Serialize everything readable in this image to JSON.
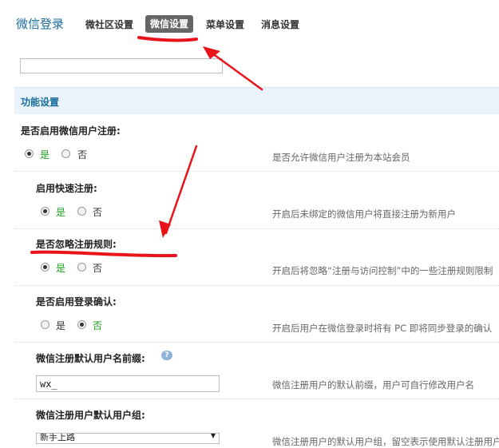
{
  "header": {
    "title": "微信登录",
    "tabs": [
      {
        "label": "微社区设置"
      },
      {
        "label": "微信设置",
        "active": true
      },
      {
        "label": "菜单设置"
      },
      {
        "label": "消息设置"
      }
    ]
  },
  "search": {
    "value": ""
  },
  "section": {
    "title": "功能设置"
  },
  "settings": [
    {
      "label": "是否启用微信用户注册:",
      "yes": "是",
      "no": "否",
      "selected": "yes",
      "desc": "是否允许微信用户注册为本站会员"
    },
    {
      "label": "启用快速注册:",
      "yes": "是",
      "no": "否",
      "selected": "yes",
      "desc": "开启后未绑定的微信用户将直接注册为新用户"
    },
    {
      "label": "是否忽略注册规则:",
      "yes": "是",
      "no": "否",
      "selected": "yes",
      "desc": "开启后将忽略“注册与访问控制”中的一些注册规则限制"
    },
    {
      "label": "是否启用登录确认:",
      "yes": "是",
      "no": "否",
      "selected": "no",
      "desc": "开启后用户在微信登录时将有 PC 即将同步登录的确认"
    },
    {
      "label": "微信注册默认用户名前缀:",
      "value": "wx_",
      "desc": "微信注册用户的默认前缀，用户可自行修改用户名"
    },
    {
      "label": "微信注册用户默认用户组:",
      "value": "新手上路",
      "desc": "微信注册用户的默认用户组，留空表示使用默认注册用户组"
    }
  ],
  "colors": {
    "accent": "#1a6d9b",
    "selected_option": "#1e9e1e",
    "annotation": "#e8141a",
    "section_bg": "#eaf3fb"
  },
  "icons": {
    "help": "speech-bubble-help-icon",
    "select_arrow": "triangle-down-icon"
  }
}
